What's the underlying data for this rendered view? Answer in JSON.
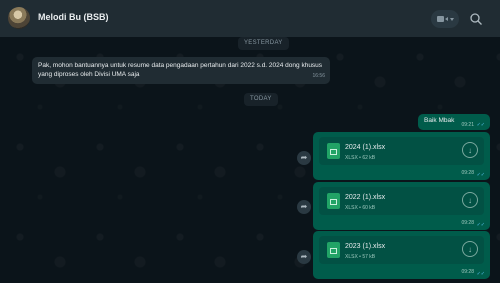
{
  "header": {
    "chat_name": "Melodi Bu (BSB)"
  },
  "dates": {
    "yesterday": "YESTERDAY",
    "today": "TODAY"
  },
  "messages": {
    "incoming_text": "Pak, mohon bantuannya untuk resume data pengadaan pertahun dari 2022 s.d. 2024 dong khusus yang diproses oleh Divisi UMA saja",
    "incoming_time": "16:56",
    "outgoing_text": "Baik Mbak",
    "outgoing_time": "09:21"
  },
  "files": [
    {
      "name": "2024 (1).xlsx",
      "meta": "XLSX • 62 kB",
      "time": "09:28"
    },
    {
      "name": "2022 (1).xlsx",
      "meta": "XLSX • 60 kB",
      "time": "09:28"
    },
    {
      "name": "2023 (1).xlsx",
      "meta": "XLSX • 57 kB",
      "time": "09:28"
    }
  ],
  "icons": {
    "video": "video-call-icon",
    "search": "search-icon",
    "download": "download-icon",
    "forward": "forward-icon",
    "read": "double-check-icon"
  },
  "colors": {
    "background": "#0b141a",
    "header": "#202c33",
    "outgoing_bubble": "#005c4b",
    "incoming_bubble": "#202c33",
    "read_tick": "#53bdeb"
  }
}
